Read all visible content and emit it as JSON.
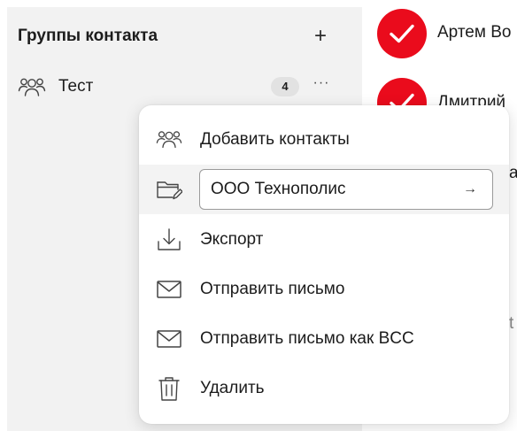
{
  "sidebar": {
    "title": "Группы контакта",
    "add_icon": "plus-icon",
    "add_glyph": "+",
    "groups": [
      {
        "label": "Тест",
        "count": "4",
        "icon": "group-users-icon",
        "more_glyph": "···"
      }
    ]
  },
  "contacts": {
    "items": [
      {
        "name": "Артем Во",
        "selected": true
      },
      {
        "name": "Дмитрий",
        "selected": true
      }
    ],
    "peek_fragments": [
      "а",
      "t"
    ]
  },
  "context_menu": {
    "items": [
      {
        "label": "Добавить контакты",
        "icon": "add-users-icon"
      },
      {
        "label": "",
        "icon": "folder-edit-icon",
        "type": "rename-input"
      },
      {
        "label": "Экспорт",
        "icon": "download-icon"
      },
      {
        "label": "Отправить письмо",
        "icon": "mail-icon"
      },
      {
        "label": "Отправить письмо как BCC",
        "icon": "mail-icon"
      },
      {
        "label": "Удалить",
        "icon": "trash-icon"
      }
    ],
    "rename": {
      "value": "ООО Технополис",
      "submit_glyph": "→"
    }
  },
  "colors": {
    "avatar_red": "#ea0b1c",
    "sidebar_bg": "#f2f2f2",
    "highlight_bg": "#f3f3f3"
  }
}
